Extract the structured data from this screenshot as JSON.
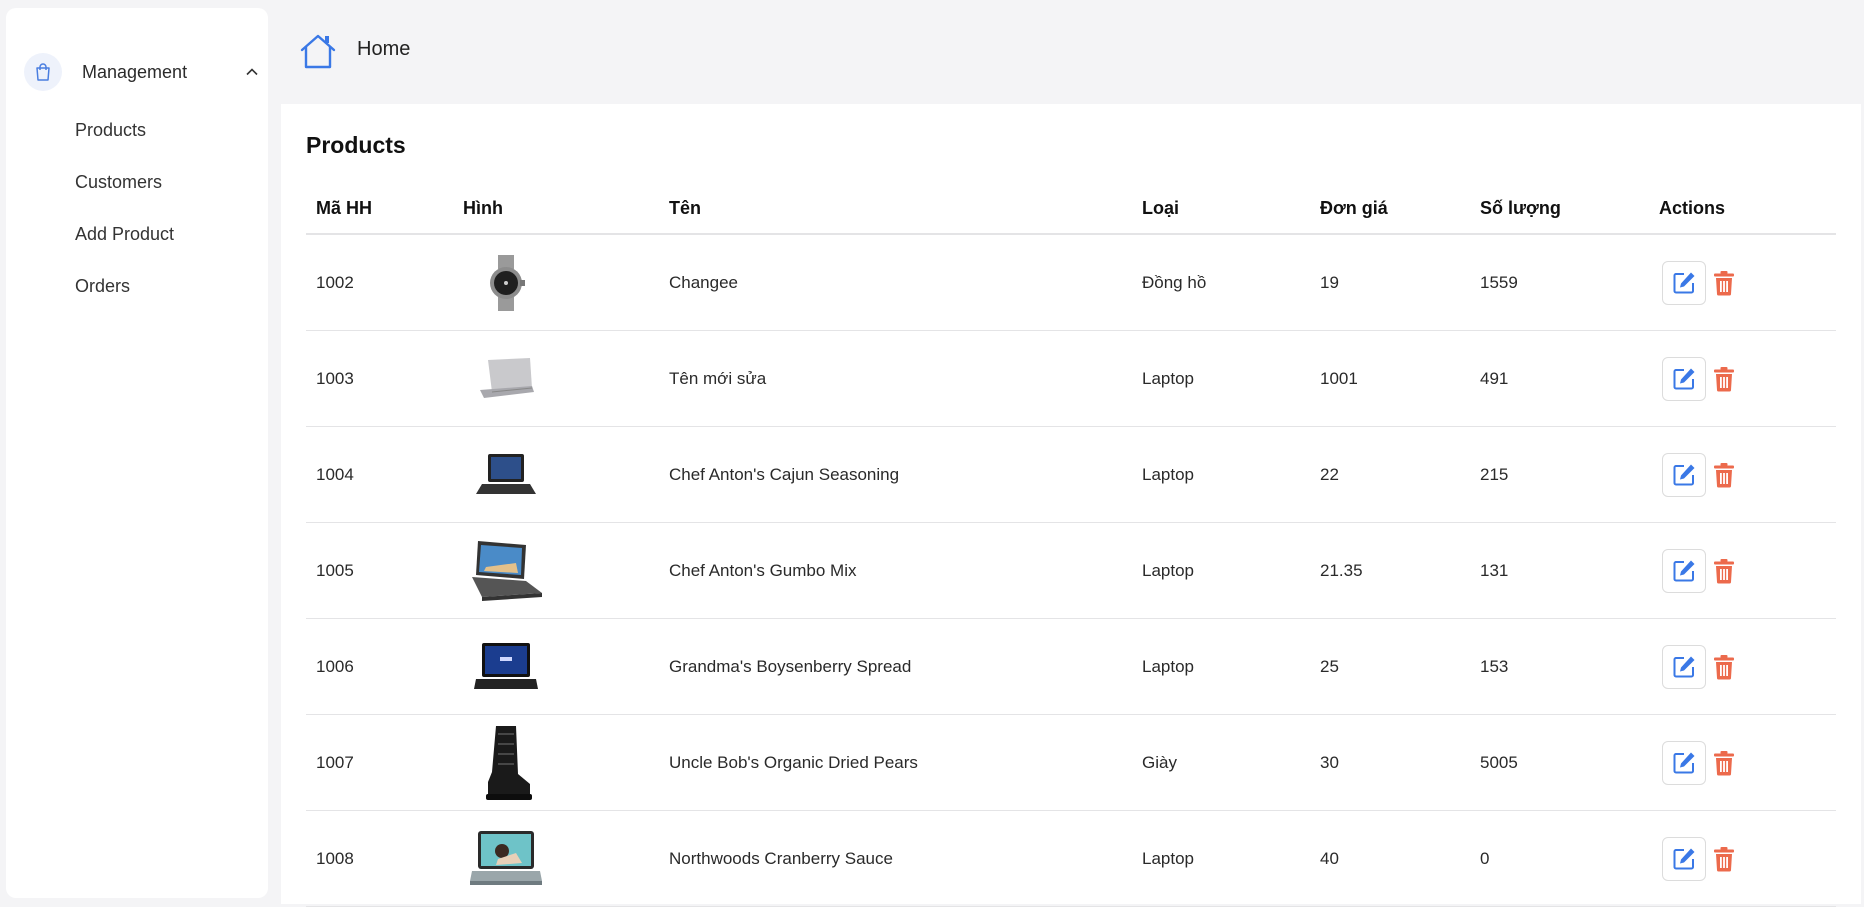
{
  "sidebar": {
    "menu_title": "Management",
    "items": [
      {
        "label": "Products"
      },
      {
        "label": "Customers"
      },
      {
        "label": "Add Product"
      },
      {
        "label": "Orders"
      }
    ]
  },
  "topbar": {
    "home_label": "Home"
  },
  "main": {
    "title": "Products",
    "columns": [
      "Mã HH",
      "Hình",
      "Tên",
      "Loại",
      "Đơn giá",
      "Số lượng",
      "Actions"
    ],
    "rows": [
      {
        "id": "1002",
        "image": "watch",
        "name": "Changee",
        "type": "Đồng hồ",
        "price": "19",
        "qty": "1559"
      },
      {
        "id": "1003",
        "image": "laptop-silver",
        "name": "Tên mới sửa",
        "type": "Laptop",
        "price": "1001",
        "qty": "491"
      },
      {
        "id": "1004",
        "image": "laptop-small",
        "name": "Chef Anton's Cajun Seasoning",
        "type": "Laptop",
        "price": "22",
        "qty": "215"
      },
      {
        "id": "1005",
        "image": "laptop-wide",
        "name": "Chef Anton's Gumbo Mix",
        "type": "Laptop",
        "price": "21.35",
        "qty": "131"
      },
      {
        "id": "1006",
        "image": "laptop-asus",
        "name": "Grandma's Boysenberry Spread",
        "type": "Laptop",
        "price": "25",
        "qty": "153"
      },
      {
        "id": "1007",
        "image": "boot",
        "name": "Uncle Bob's Organic Dried Pears",
        "type": "Giày",
        "price": "30",
        "qty": "5005"
      },
      {
        "id": "1008",
        "image": "laptop-photo",
        "name": "Northwoods Cranberry Sauce",
        "type": "Laptop",
        "price": "40",
        "qty": "0"
      }
    ]
  },
  "colors": {
    "accent_blue": "#3a78e6",
    "delete_red": "#ec6a4c",
    "background": "#f4f4f6"
  },
  "icons": {
    "menu": "shopping-bag-icon",
    "chevron": "chevron-up-icon",
    "home": "home-icon",
    "edit": "edit-icon",
    "delete": "trash-icon"
  }
}
